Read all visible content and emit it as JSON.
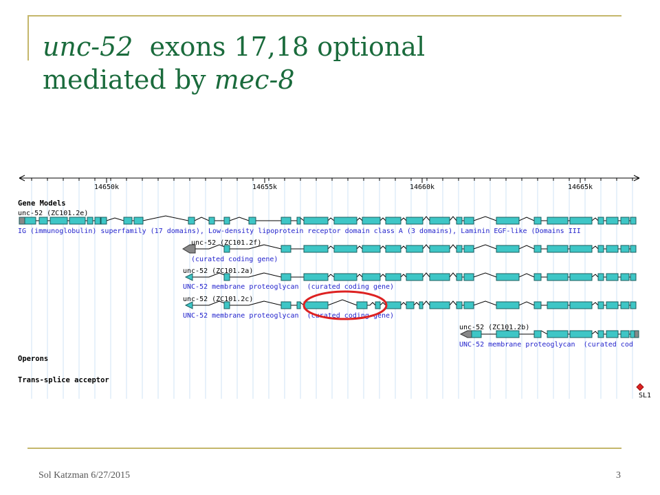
{
  "slide": {
    "title_line1_italic": "unc-52",
    "title_line1_rest": "  exons 17,18 optional",
    "title_line2_start": "mediated by ",
    "title_line2_italic": "mec-8",
    "footer_left": "Sol Katzman 6/27/2015",
    "page_number": "3"
  },
  "browser": {
    "ruler_ticks": [
      "14650k",
      "14655k",
      "14660k",
      "14665k"
    ],
    "section_gene_models": "Gene Models",
    "section_operons": "Operons",
    "section_trans_splice": "Trans-splice acceptor",
    "sl1_label": "SL1",
    "genes": [
      {
        "name": "unc-52 (ZC101.2e)",
        "desc": "IG (immunoglobulin) superfamily (17 domains), Low-density lipoprotein receptor domain class A (3 domains), Laminin EGF-like (Domains III"
      },
      {
        "name": "unc-52 (ZC101.2f)",
        "desc": "(curated coding gene)"
      },
      {
        "name": "unc-52 (ZC101.2a)",
        "desc": "UNC-52 membrane proteoglycan  (curated coding gene)"
      },
      {
        "name": "unc-52 (ZC101.2c)",
        "desc": "UNC-52 membrane proteoglycan  (curated coding gene)"
      },
      {
        "name": "unc-52 (ZC101.2b)",
        "desc": "UNC-52 membrane proteoglycan  (curated cod"
      }
    ],
    "colors": {
      "exon": "#3ec6c6",
      "exon_stroke": "#1a5c5c",
      "label_blue": "#2222cc",
      "highlight": "#dd2222",
      "grid": "#cfe3f5"
    }
  }
}
